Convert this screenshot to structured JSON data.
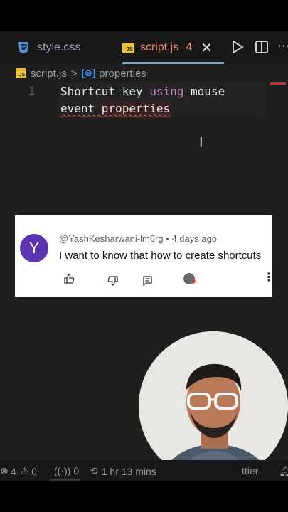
{
  "tabs": [
    {
      "icon": "css3-icon",
      "label": "style.css"
    },
    {
      "icon": "js-file-icon",
      "label": "script.js",
      "problems": "4",
      "active": true
    }
  ],
  "js_badge": "JS",
  "breadcrumb": {
    "file": "script.js",
    "separator": ">",
    "symbol": "properties"
  },
  "editor": {
    "line_number": "1",
    "line1_a": "Shortcut key ",
    "line1_kw": "using",
    "line1_b": " mouse",
    "line2_a": "event ",
    "line2_b": "properties"
  },
  "comment": {
    "avatar_letter": "Y",
    "author": "@YashKesharwani-lm6rg",
    "dot": "•",
    "time": "4 days ago",
    "text": "I want to know that how to create shortcuts"
  },
  "status_bar": {
    "errors": "4",
    "warnings": "0",
    "ports": "0",
    "time_tracked": "1 hr 13 mins",
    "formatter": "ttier"
  },
  "colors": {
    "editor_bg": "#1e1e1e",
    "active_tab": "#f48771",
    "keyword": "#c586c0",
    "avatar": "#5e35b1"
  }
}
